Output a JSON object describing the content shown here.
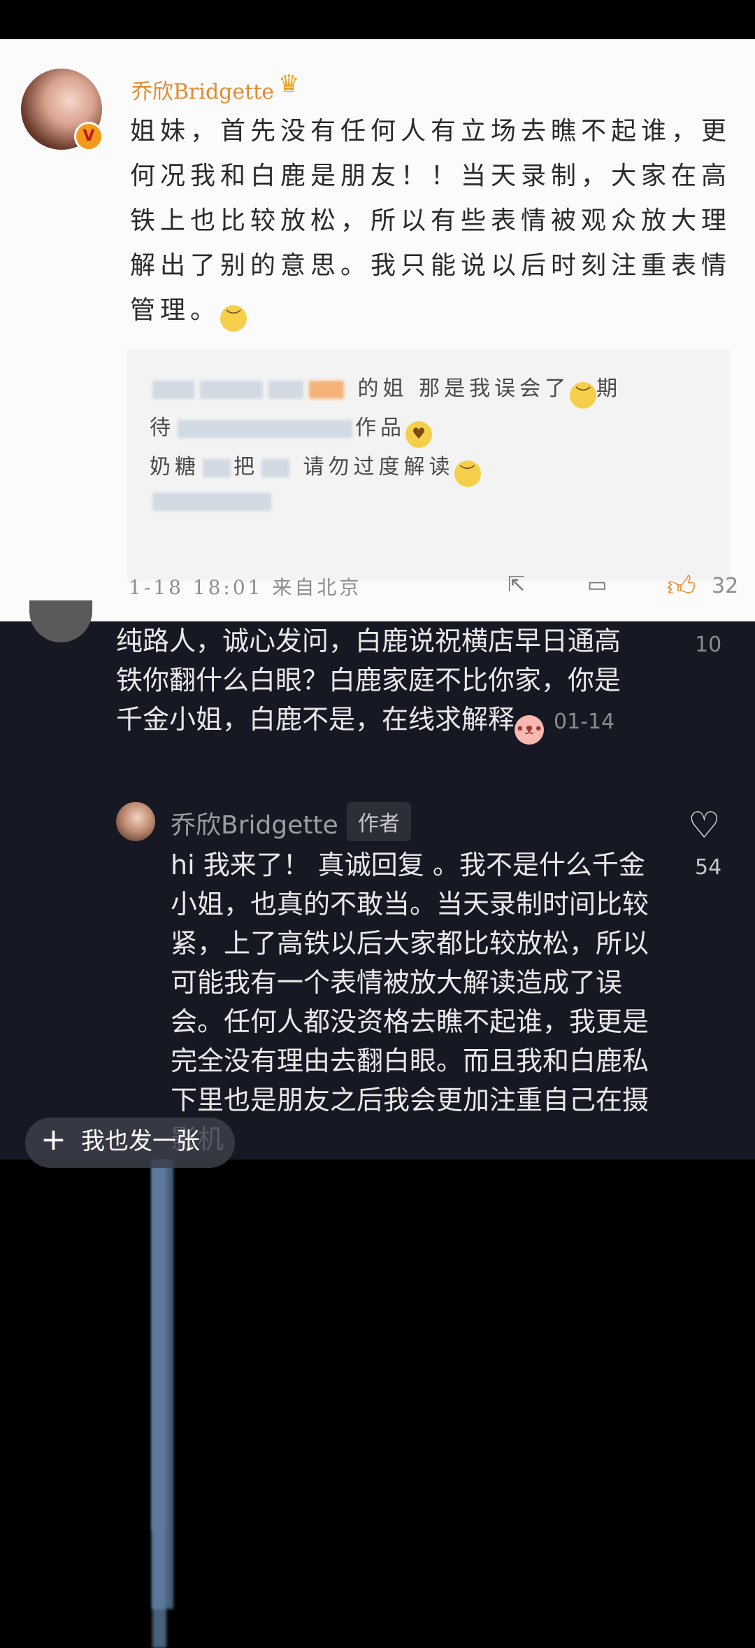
{
  "weibo_post": {
    "username": "乔欣Bridgette",
    "verified_badge": "V",
    "body": "姐妹，首先没有任何人有立场去瞧不起谁，更何况我和白鹿是朋友！！当天录制，大家在高铁上也比较放松，所以有些表情被观众放大理解出了别的意思。我只能说以后时刻注重表情管理。",
    "quoted_lines": {
      "line1_end": "的姐 那是我误会了",
      "line1_tail": "期",
      "line2_start": "待",
      "line2_end": "作品",
      "line3_start": "奶糖",
      "line3_mid": "把",
      "line3_end": "请勿过度解读"
    },
    "timestamp": "1-18 18:01",
    "source": "来自北京",
    "like_count": "32",
    "icons": [
      "share-icon",
      "comment-icon",
      "like-thumb-icon",
      "crown-icon"
    ]
  },
  "comments": [
    {
      "text": "纯路人，诚心发问，白鹿说祝横店早日通高铁你翻什么白眼？白鹿家庭不比你家，你是千金小姐，白鹿不是，在线求解释",
      "date": "01-14",
      "like_count": "10"
    },
    {
      "author": "乔欣Bridgette",
      "author_tag": "作者",
      "text": "hi 我来了！ 真诚回复 。我不是什么千金小姐，也真的不敢当。当天录制时间比较紧，上了高铁以后大家都比较放松，所以可能我有一个表情被放大解读造成了误会。任何人都没资格去瞧不起谁，我更是完全没有理由去翻白眼。而且我和白鹿私下里也是朋友之后我会更加注重自己在摄影机",
      "like_count": "54"
    }
  ],
  "bottom_button": {
    "label": "我也发一张"
  }
}
